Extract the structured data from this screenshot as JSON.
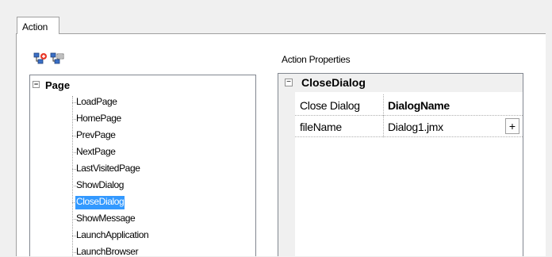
{
  "tab": {
    "label": "Action"
  },
  "toolbar": {
    "icons": [
      "add-action-icon",
      "edit-action-icon"
    ]
  },
  "tree": {
    "root_label": "Page",
    "items": [
      {
        "label": "LoadPage"
      },
      {
        "label": "HomePage"
      },
      {
        "label": "PrevPage"
      },
      {
        "label": "NextPage"
      },
      {
        "label": "LastVisitedPage"
      },
      {
        "label": "ShowDialog"
      },
      {
        "label": "CloseDialog",
        "selected": true
      },
      {
        "label": "ShowMessage"
      },
      {
        "label": "LaunchApplication"
      },
      {
        "label": "LaunchBrowser"
      }
    ]
  },
  "properties": {
    "heading": "Action Properties",
    "category": "CloseDialog",
    "rows": [
      {
        "name": "Close Dialog",
        "value": "DialogName"
      },
      {
        "name": "fileName",
        "value": "Dialog1.jmx",
        "button": "+"
      }
    ]
  },
  "colors": {
    "selection": "#3399ff",
    "panel_bg": "#ffffff",
    "chrome_bg": "#f0f0f0"
  }
}
